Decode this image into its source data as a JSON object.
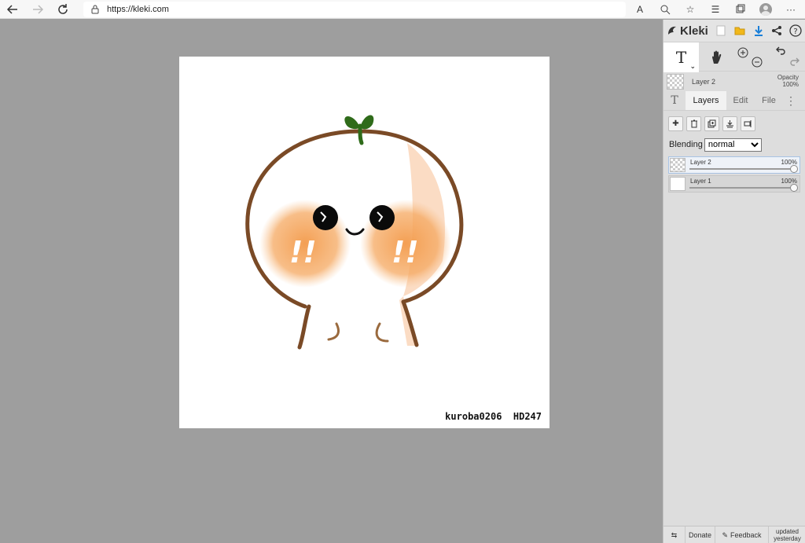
{
  "browser": {
    "url": "https://kleki.com"
  },
  "app": {
    "name": "Kleki"
  },
  "canvas": {
    "signature": "kuroba0206  HD247",
    "exclaim_left": "!!",
    "exclaim_right": "!!"
  },
  "layer_info": {
    "name": "Layer 2",
    "opacity_label": "Opacity",
    "opacity_value": "100%"
  },
  "tabs": {
    "layers": "Layers",
    "edit": "Edit",
    "file": "File"
  },
  "blending": {
    "label": "Blending",
    "value": "normal"
  },
  "layers": [
    {
      "name": "Layer 2",
      "opacity": "100%",
      "opacity_fraction": 1.0,
      "selected": true
    },
    {
      "name": "Layer 1",
      "opacity": "100%",
      "opacity_fraction": 1.0,
      "selected": false
    }
  ],
  "footer": {
    "donate": "Donate",
    "feedback": "Feedback",
    "updated_line1": "updated",
    "updated_line2": "yesterday"
  },
  "colors": {
    "canvas_bg": "#9e9e9e",
    "panel_bg": "#dddddd",
    "outline": "#7a4a26",
    "blush": "#f39a4a",
    "sprout": "#2f6b1a"
  }
}
